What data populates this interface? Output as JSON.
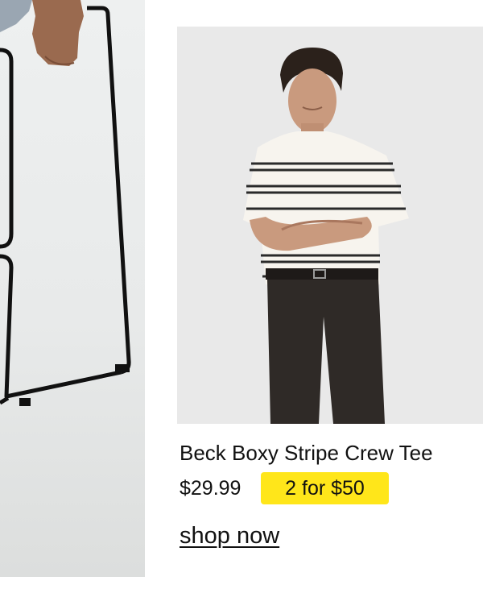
{
  "left_panel": {
    "image": "model-seated-on-stool-photo"
  },
  "product": {
    "image": "model-in-striped-tee-photo",
    "name": "Beck Boxy Stripe Crew Tee",
    "price": "$29.99",
    "promo": "2 for $50",
    "cta": "shop now"
  },
  "colors": {
    "promo_badge": "#ffe61a",
    "text": "#111111",
    "photo_bg": "#e9e9e9"
  }
}
